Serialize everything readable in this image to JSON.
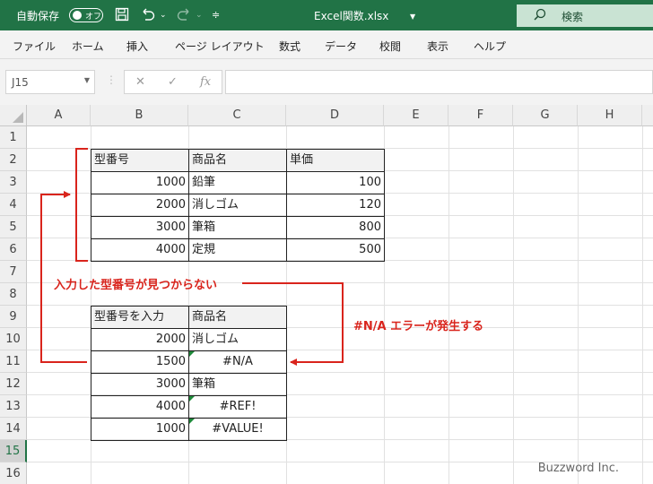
{
  "titlebar": {
    "autosave_label": "自動保存",
    "toggle_label": "オフ",
    "filename": "Excel関数.xlsx",
    "search_label": "検索"
  },
  "menu": [
    "ファイル",
    "ホーム",
    "挿入",
    "ページ レイアウト",
    "数式",
    "データ",
    "校閲",
    "表示",
    "ヘルプ"
  ],
  "formula_bar": {
    "name_box": "J15",
    "cancel_glyph": "✕",
    "enter_glyph": "✓",
    "fx_glyph": "fx",
    "value": ""
  },
  "columns": [
    "A",
    "B",
    "C",
    "D",
    "E",
    "F",
    "G",
    "H"
  ],
  "rows": [
    "1",
    "2",
    "3",
    "4",
    "5",
    "6",
    "7",
    "8",
    "9",
    "10",
    "11",
    "12",
    "13",
    "14",
    "15",
    "16"
  ],
  "selected_row": "15",
  "table1": {
    "headers": [
      "型番号",
      "商品名",
      "単価"
    ],
    "rows": [
      [
        "1000",
        "鉛筆",
        "100"
      ],
      [
        "2000",
        "消しゴム",
        "120"
      ],
      [
        "3000",
        "筆箱",
        "800"
      ],
      [
        "4000",
        "定規",
        "500"
      ]
    ]
  },
  "table2": {
    "headers": [
      "型番号を入力",
      "商品名"
    ],
    "rows": [
      [
        "2000",
        "消しゴム"
      ],
      [
        "1500",
        "#N/A"
      ],
      [
        "3000",
        "筆箱"
      ],
      [
        "4000",
        "#REF!"
      ],
      [
        "1000",
        "#VALUE!"
      ]
    ]
  },
  "annotations": {
    "not_found": "入力した型番号が見つからない",
    "na_error": "#N/A エラーが発生する"
  },
  "watermark": "Buzzword Inc.",
  "colors": {
    "excel_green": "#217346",
    "annotation_red": "#d9241c"
  }
}
